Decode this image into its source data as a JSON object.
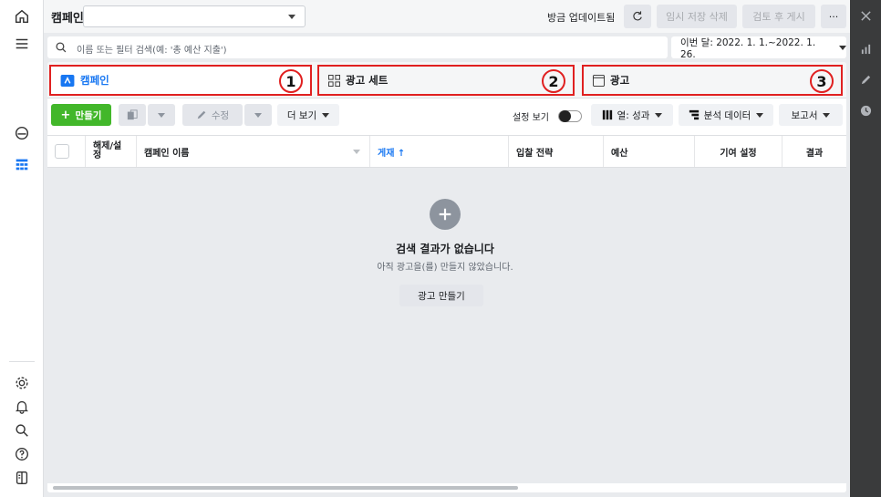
{
  "header": {
    "title": "캠페인",
    "campaign_select_value": "",
    "update_status": "방금 업데이트됨",
    "discard_drafts": "임시 저장 삭제",
    "review_publish": "검토 후 게시",
    "more": "···"
  },
  "search": {
    "placeholder": "이름 또는 필터 검색(예: '총 예산 지출')"
  },
  "date_range": "이번 달: 2022. 1. 1.~2022. 1. 26.",
  "tabs": [
    {
      "label": "캠페인",
      "number": "1"
    },
    {
      "label": "광고 세트",
      "number": "2"
    },
    {
      "label": "광고",
      "number": "3"
    }
  ],
  "toolbar": {
    "create": "만들기",
    "edit": "수정",
    "more": "더 보기",
    "setting_view": "설정 보기",
    "columns": "열: 성과",
    "breakdown": "분석 데이터",
    "reports": "보고서"
  },
  "table": {
    "columns": [
      "해제/설정",
      "캠페인 이름",
      "게재 ↑",
      "입찰 전략",
      "예산",
      "기여 설정",
      "결과"
    ]
  },
  "empty_state": {
    "title": "검색 결과가 없습니다",
    "subtitle": "아직 광고을(를) 만들지 않았습니다.",
    "button": "광고 만들기"
  },
  "colors": {
    "accent": "#1877f2",
    "create_green": "#42b72a",
    "highlight_red": "#e02020"
  }
}
